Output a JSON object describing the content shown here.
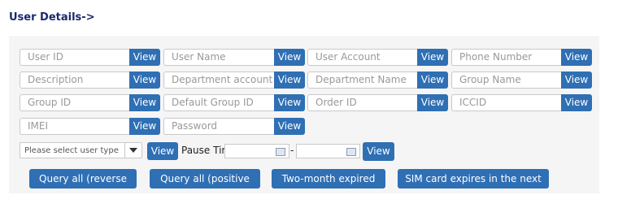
{
  "title": "User Details->",
  "fields": [
    {
      "placeholder": "User ID",
      "button": "View"
    },
    {
      "placeholder": "User Name",
      "button": "View"
    },
    {
      "placeholder": "User Account",
      "button": "View"
    },
    {
      "placeholder": "Phone Number",
      "button": "View"
    },
    {
      "placeholder": "Description",
      "button": "View"
    },
    {
      "placeholder": "Department account",
      "button": "View"
    },
    {
      "placeholder": "Department Name",
      "button": "View"
    },
    {
      "placeholder": "Group Name",
      "button": "View"
    },
    {
      "placeholder": "Group ID",
      "button": "View"
    },
    {
      "placeholder": "Default Group ID",
      "button": "View"
    },
    {
      "placeholder": "Order ID",
      "button": "View"
    },
    {
      "placeholder": "ICCID",
      "button": "View"
    },
    {
      "placeholder": "IMEI",
      "button": "View"
    },
    {
      "placeholder": "Password",
      "button": "View"
    }
  ],
  "user_type": {
    "selected": "Please select user type",
    "button": "View"
  },
  "pause_time": {
    "label": "Pause Time:",
    "separator": "-",
    "button": "View"
  },
  "actions": {
    "reverse": "Query all (reverse order)",
    "positive": "Query all (positive order)",
    "expired": "Two-month expired users",
    "sim_expiring": "SIM card expires in the next month"
  }
}
